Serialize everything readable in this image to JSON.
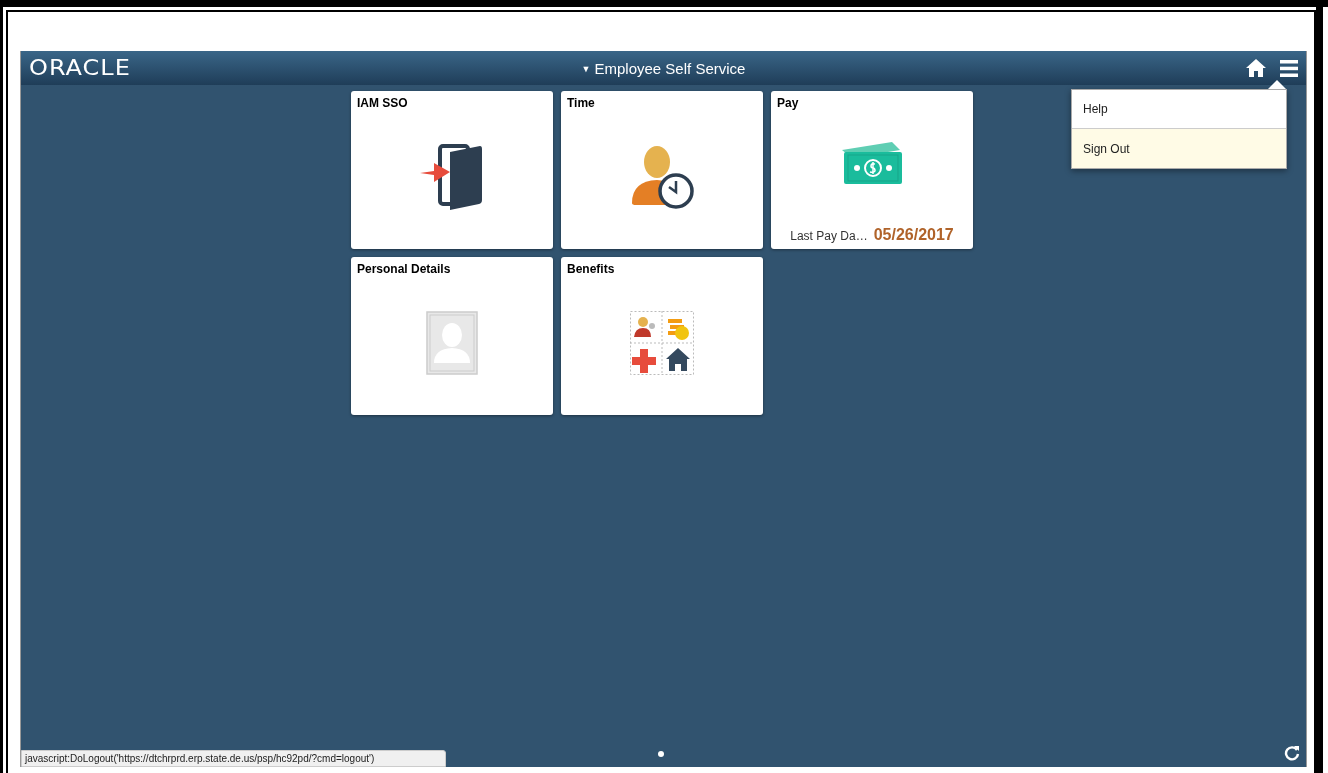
{
  "header": {
    "logo": "ORACLE",
    "title_caret": "▼",
    "title": "Employee Self Service"
  },
  "tiles": [
    {
      "title": "IAM SSO",
      "kind": "door"
    },
    {
      "title": "Time",
      "kind": "timeclock"
    },
    {
      "title": "Pay",
      "kind": "money",
      "footer_label": "Last Pay Da…",
      "footer_value": "05/26/2017"
    },
    {
      "title": "Personal Details",
      "kind": "photo"
    },
    {
      "title": "Benefits",
      "kind": "benefits"
    }
  ],
  "menu": {
    "items": [
      {
        "label": "Help",
        "highlighted": false
      },
      {
        "label": "Sign Out",
        "highlighted": true
      }
    ]
  },
  "page_dots": [
    {
      "selected": true
    }
  ],
  "status_bar": {
    "text": "javascript:DoLogout('https://dtchrprd.erp.state.de.us/psp/hc92pd/?cmd=logout')"
  }
}
